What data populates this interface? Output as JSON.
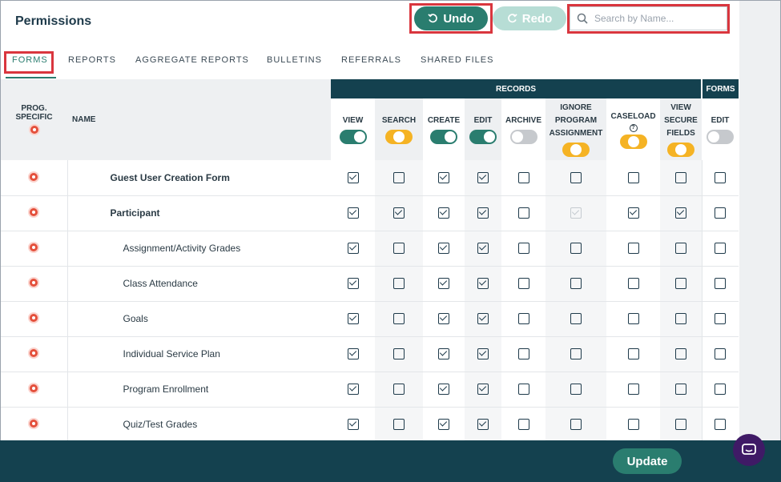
{
  "header": {
    "title": "Permissions",
    "undo_label": "Undo",
    "redo_label": "Redo",
    "search_placeholder": "Search by Name..."
  },
  "tabs": [
    {
      "label": "FORMS",
      "active": true
    },
    {
      "label": "REPORTS",
      "active": false
    },
    {
      "label": "AGGREGATE REPORTS",
      "active": false
    },
    {
      "label": "BULLETINS",
      "active": false
    },
    {
      "label": "REFERRALS",
      "active": false
    },
    {
      "label": "SHARED FILES",
      "active": false
    }
  ],
  "table": {
    "groups": {
      "records": "RECORDS",
      "forms": "FORMS"
    },
    "left_headers": {
      "prog_specific_line1": "PROG.",
      "prog_specific_line2": "SPECIFIC",
      "name": "NAME"
    },
    "columns": [
      {
        "label": "VIEW",
        "toggle": "green"
      },
      {
        "label": "SEARCH",
        "toggle": "yellow"
      },
      {
        "label": "CREATE",
        "toggle": "green"
      },
      {
        "label": "EDIT",
        "toggle": "green"
      },
      {
        "label": "ARCHIVE",
        "toggle": "gray"
      },
      {
        "label_lines": [
          "IGNORE",
          "PROGRAM",
          "ASSIGNMENT"
        ],
        "toggle": "yellow"
      },
      {
        "label": "CASELOAD",
        "help": "?",
        "toggle": "yellow"
      },
      {
        "label_lines": [
          "VIEW",
          "SECURE",
          "FIELDS"
        ],
        "toggle": "yellow"
      },
      {
        "label": "EDIT",
        "toggle": "gray"
      }
    ],
    "rows": [
      {
        "name": "Guest User Creation Form",
        "bold": true,
        "indent": false,
        "checks": [
          true,
          false,
          true,
          true,
          false,
          false,
          false,
          false,
          false
        ]
      },
      {
        "name": "Participant",
        "bold": true,
        "indent": false,
        "checks": [
          true,
          true,
          true,
          true,
          false,
          "disabled-checked",
          true,
          true,
          false
        ]
      },
      {
        "name": "Assignment/Activity Grades",
        "bold": false,
        "indent": true,
        "checks": [
          true,
          false,
          true,
          true,
          false,
          false,
          false,
          false,
          false
        ]
      },
      {
        "name": "Class Attendance",
        "bold": false,
        "indent": true,
        "checks": [
          true,
          false,
          true,
          true,
          false,
          false,
          false,
          false,
          false
        ]
      },
      {
        "name": "Goals",
        "bold": false,
        "indent": true,
        "checks": [
          true,
          false,
          true,
          true,
          false,
          false,
          false,
          false,
          false
        ]
      },
      {
        "name": "Individual Service Plan",
        "bold": false,
        "indent": true,
        "checks": [
          true,
          false,
          true,
          true,
          false,
          false,
          false,
          false,
          false
        ]
      },
      {
        "name": "Program Enrollment",
        "bold": false,
        "indent": true,
        "checks": [
          true,
          false,
          true,
          true,
          false,
          false,
          false,
          false,
          false
        ]
      },
      {
        "name": "Quiz/Test Grades",
        "bold": false,
        "indent": true,
        "checks": [
          true,
          false,
          true,
          true,
          false,
          false,
          false,
          false,
          false
        ]
      }
    ]
  },
  "footer": {
    "update_label": "Update"
  },
  "colors": {
    "accent": "#2a7d6f",
    "navy": "#14414f",
    "highlight": "#d9363e",
    "toggle_yellow": "#f5b324",
    "target_red": "#e4503c"
  }
}
